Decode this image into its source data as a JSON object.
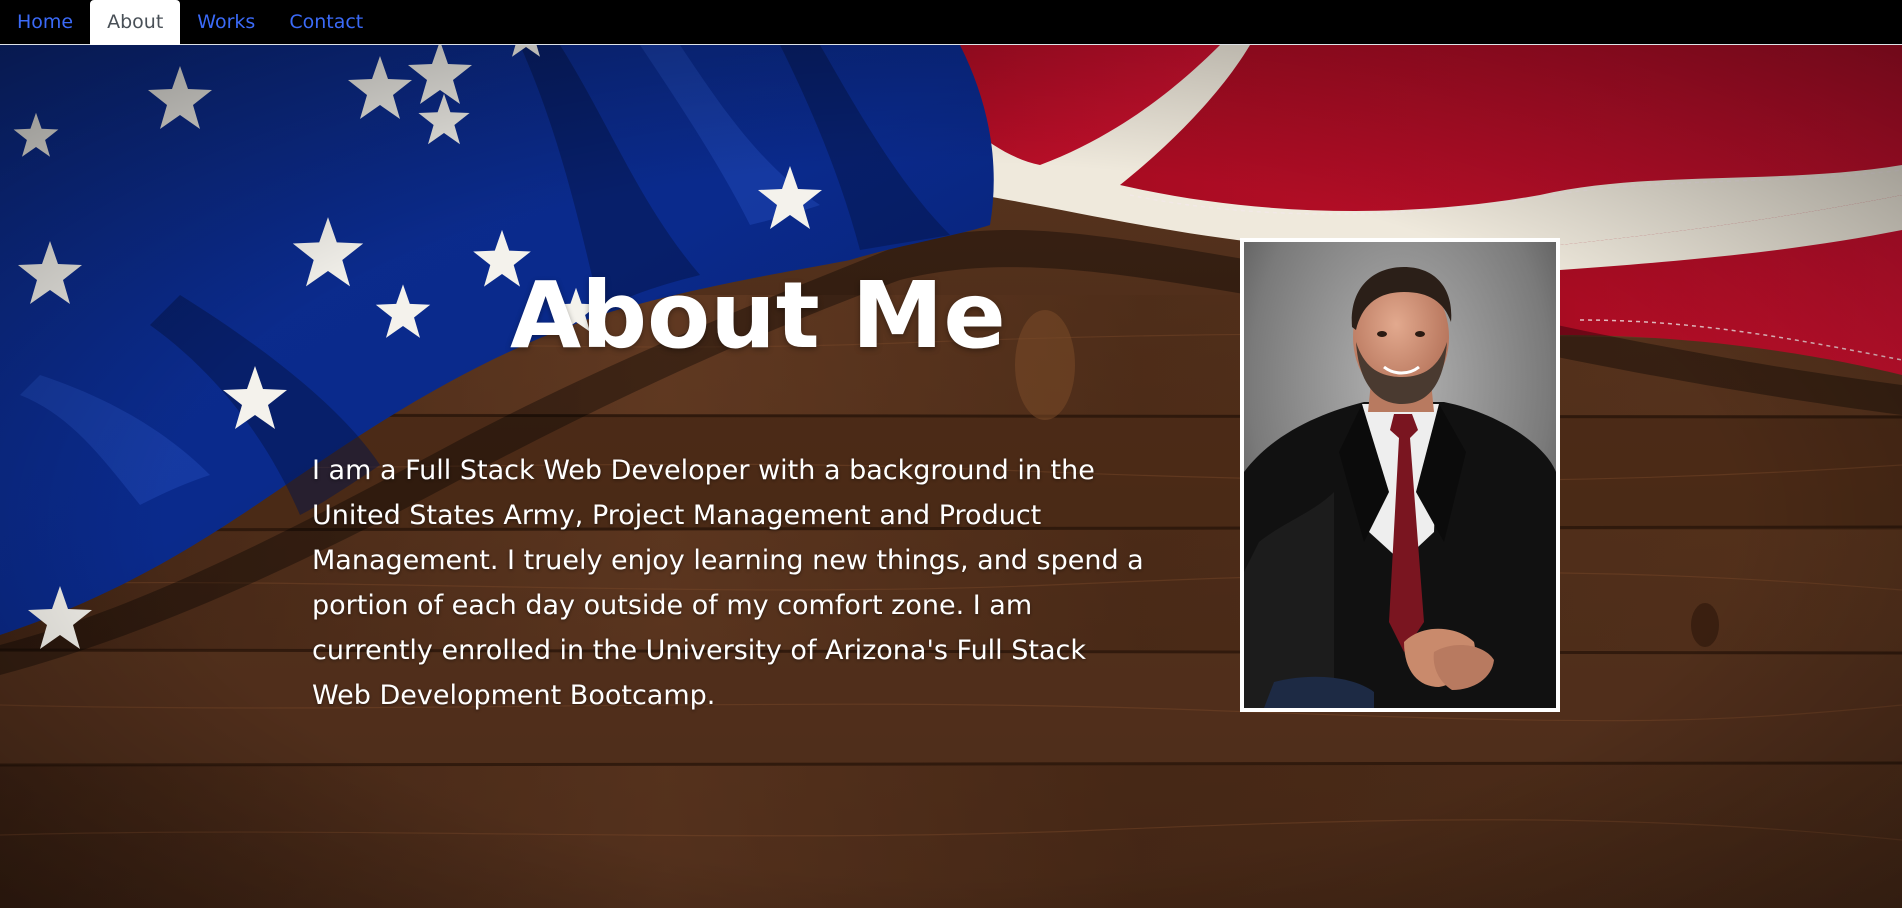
{
  "nav": {
    "items": [
      {
        "label": "Home",
        "active": false
      },
      {
        "label": "About",
        "active": true
      },
      {
        "label": "Works",
        "active": false
      },
      {
        "label": "Contact",
        "active": false
      }
    ]
  },
  "main": {
    "title": "About Me",
    "paragraph": "I am a Full Stack Web Developer with a background in the United States Army, Project Management and Product Management. I truely enjoy learning new things, and spend a portion of each day outside of my comfort zone. I am currently enrolled in the University of Arizona's Full Stack Web Development Bootcamp."
  },
  "colors": {
    "nav_background": "#000000",
    "nav_link": "#3b6af7",
    "nav_active_background": "#ffffff",
    "nav_active_text": "#495057",
    "flag_blue": "#0a2a8c",
    "flag_red": "#c8102e",
    "flag_white": "#efe9dc",
    "wood": "#4a2a17"
  }
}
